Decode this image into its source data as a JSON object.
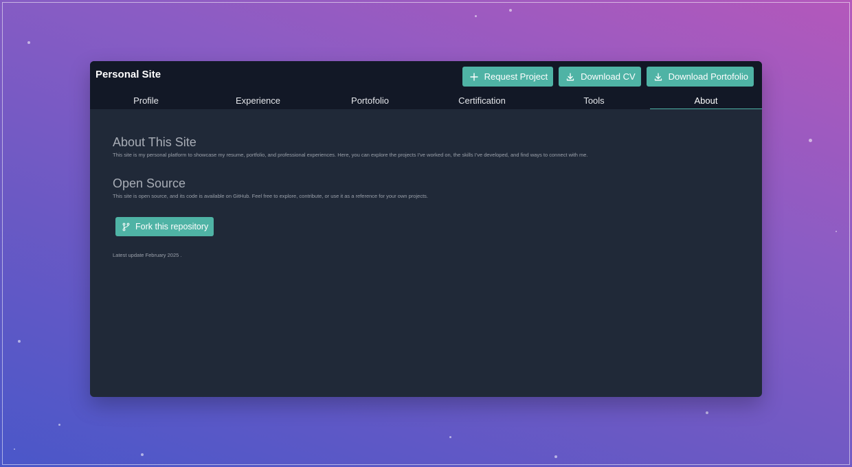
{
  "app": {
    "title": "Personal Site"
  },
  "actions": [
    {
      "label": "Request Project",
      "icon": "plus-icon"
    },
    {
      "label": "Download CV",
      "icon": "download-icon"
    },
    {
      "label": "Download Portofolio",
      "icon": "download-icon"
    }
  ],
  "tabs": [
    "Profile",
    "Experience",
    "Portofolio",
    "Certification",
    "Tools",
    "About"
  ],
  "active_tab": "About",
  "about": {
    "heading": "About This Site",
    "text": "This site is my personal platform to showcase my resume, portfolio, and professional experiences. Here, you can explore the projects I've worked on, the skills I've developed, and find ways to connect with me."
  },
  "open_source": {
    "heading": "Open Source",
    "text": "This site is open source, and its code is available on GitHub. Feel free to explore, contribute, or use it as a reference for your own projects."
  },
  "fork_button": {
    "label": "Fork this repository",
    "icon": "git-branch-icon"
  },
  "update_text": "Latest update February 2025 .",
  "colors": {
    "accent": "#4fb3a5",
    "panel": "#202938",
    "header": "#121826"
  }
}
